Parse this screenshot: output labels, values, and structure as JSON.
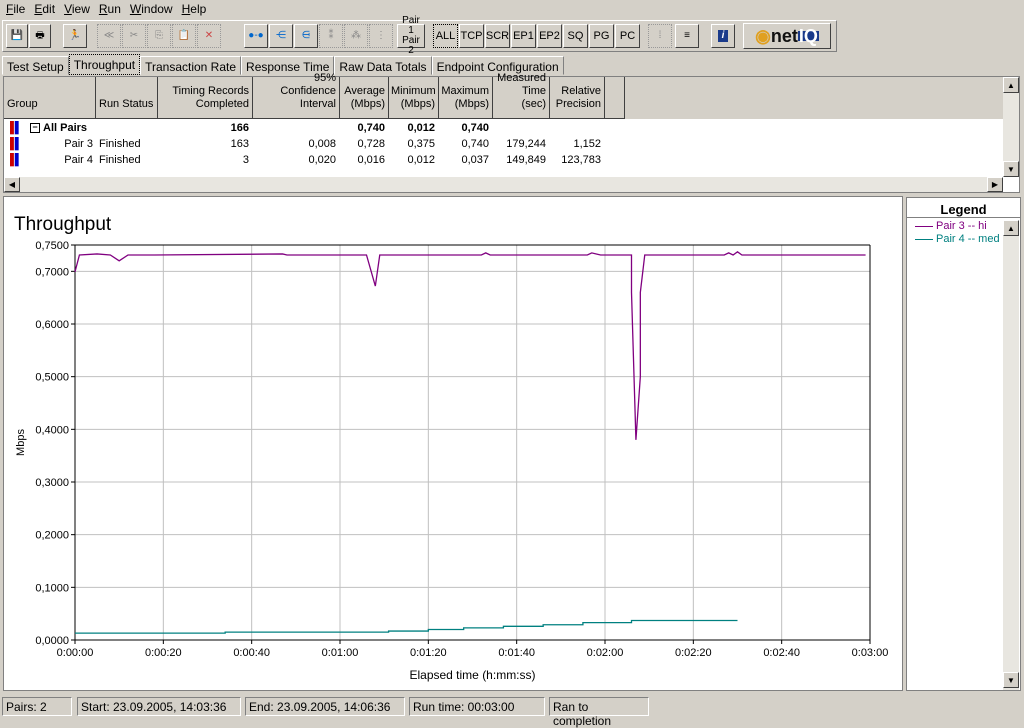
{
  "menu": [
    "File",
    "Edit",
    "View",
    "Run",
    "Window",
    "Help"
  ],
  "toolbar": {
    "pair_label_1": "Pair 1",
    "pair_label_2": "Pair 2",
    "filters": [
      "ALL",
      "TCP",
      "SCR",
      "EP1",
      "EP2",
      "SQ",
      "PG",
      "PC"
    ],
    "logo": "netIQ"
  },
  "tabs": [
    "Test Setup",
    "Throughput",
    "Transaction Rate",
    "Response Time",
    "Raw Data Totals",
    "Endpoint Configuration"
  ],
  "active_tab": "Throughput",
  "table": {
    "columns": [
      "Group",
      "Run Status",
      "Timing Records Completed",
      "95% Confidence Interval",
      "Average (Mbps)",
      "Minimum (Mbps)",
      "Maximum (Mbps)",
      "Measured Time (sec)",
      "Relative Precision"
    ],
    "rows": [
      {
        "group": "All Pairs",
        "status": "",
        "records": "166",
        "ci": "",
        "avg": "0,740",
        "min": "0,012",
        "max": "0,740",
        "time": "",
        "precision": ""
      },
      {
        "group": "Pair 3",
        "status": "Finished",
        "records": "163",
        "ci": "0,008",
        "avg": "0,728",
        "min": "0,375",
        "max": "0,740",
        "time": "179,244",
        "precision": "1,152"
      },
      {
        "group": "Pair 4",
        "status": "Finished",
        "records": "3",
        "ci": "0,020",
        "avg": "0,016",
        "min": "0,012",
        "max": "0,037",
        "time": "149,849",
        "precision": "123,783"
      }
    ]
  },
  "chart_data": {
    "type": "line",
    "title": "Throughput",
    "xlabel": "Elapsed time (h:mm:ss)",
    "ylabel": "Mbps",
    "xlim": [
      "0:00:00",
      "0:03:00"
    ],
    "ylim": [
      0,
      0.75
    ],
    "grid": true,
    "xticks": [
      "0:00:00",
      "0:00:20",
      "0:00:40",
      "0:01:00",
      "0:01:20",
      "0:01:40",
      "0:02:00",
      "0:02:20",
      "0:02:40",
      "0:03:00"
    ],
    "yticks": [
      "0,0000",
      "0,1000",
      "0,2000",
      "0,3000",
      "0,4000",
      "0,5000",
      "0,6000",
      "0,7000",
      "0,7500"
    ],
    "legend": "right",
    "series": [
      {
        "name": "Pair 3 -- hi",
        "color": "#800080",
        "x": [
          "0:00:00",
          "0:00:01",
          "0:00:05",
          "0:00:08",
          "0:00:10",
          "0:00:12",
          "0:00:18",
          "0:00:47",
          "0:00:48",
          "0:01:06",
          "0:01:08",
          "0:01:09",
          "0:01:13",
          "0:01:32",
          "0:01:33",
          "0:01:34",
          "0:01:56",
          "0:01:57",
          "0:01:59",
          "0:02:06",
          "0:02:06",
          "0:02:07",
          "0:02:08",
          "0:02:08",
          "0:02:09",
          "0:02:27",
          "0:02:28",
          "0:02:29",
          "0:02:30",
          "0:02:31",
          "0:02:59"
        ],
        "y": [
          0.699,
          0.731,
          0.733,
          0.731,
          0.72,
          0.731,
          0.731,
          0.733,
          0.731,
          0.731,
          0.672,
          0.731,
          0.731,
          0.731,
          0.735,
          0.731,
          0.731,
          0.735,
          0.731,
          0.731,
          0.66,
          0.38,
          0.5,
          0.66,
          0.731,
          0.731,
          0.735,
          0.731,
          0.737,
          0.731,
          0.731
        ]
      },
      {
        "name": "Pair 4 -- med",
        "color": "#008080",
        "x": [
          "0:00:00",
          "0:00:34",
          "0:00:34",
          "0:01:11",
          "0:01:11",
          "0:01:20",
          "0:01:20",
          "0:01:28",
          "0:01:28",
          "0:01:37",
          "0:01:37",
          "0:01:46",
          "0:01:46",
          "0:01:55",
          "0:01:55",
          "0:02:06",
          "0:02:06",
          "0:02:30"
        ],
        "y": [
          0.013,
          0.013,
          0.015,
          0.015,
          0.017,
          0.017,
          0.02,
          0.02,
          0.023,
          0.023,
          0.026,
          0.026,
          0.029,
          0.029,
          0.033,
          0.033,
          0.037,
          0.037
        ]
      }
    ]
  },
  "legend": {
    "title": "Legend"
  },
  "status": {
    "pairs": "Pairs: 2",
    "start": "Start: 23.09.2005, 14:03:36",
    "end": "End: 23.09.2005, 14:06:36",
    "runtime": "Run time: 00:03:00",
    "result": "Ran to completion"
  }
}
